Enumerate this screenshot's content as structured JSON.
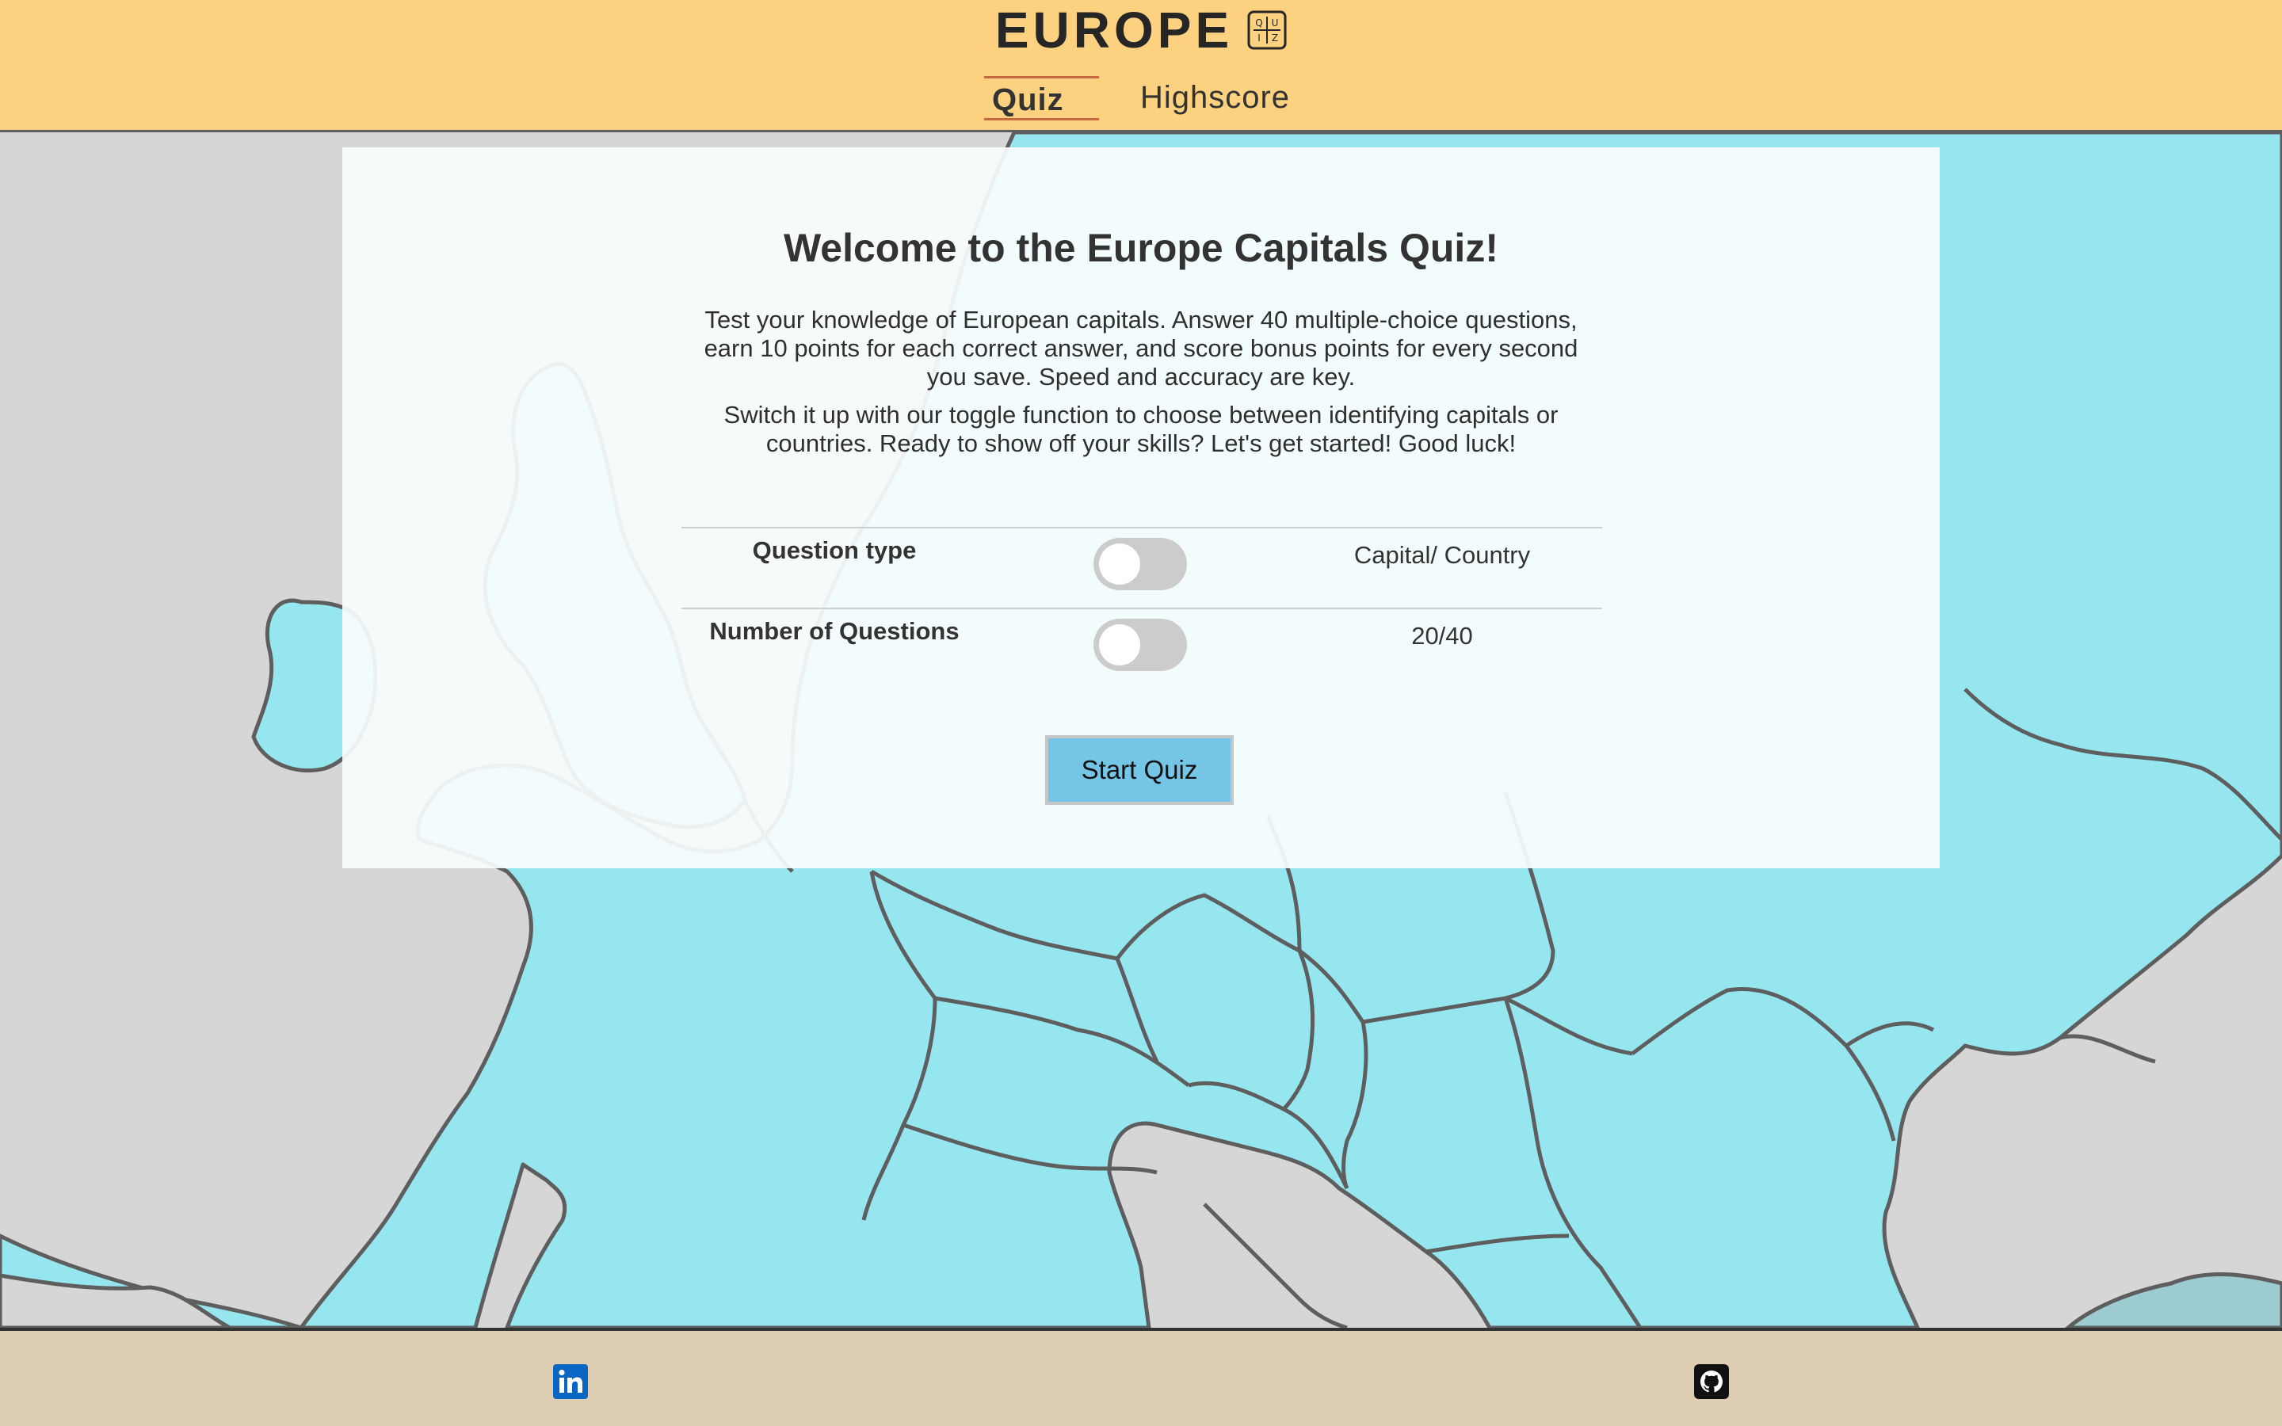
{
  "header": {
    "title": "EUROPE",
    "logo_icon": "quiz-logo-icon",
    "logo_letters": [
      "Q",
      "U",
      "I",
      "Z"
    ],
    "nav": [
      {
        "label": "Quiz",
        "active": true
      },
      {
        "label": "Highscore",
        "active": false
      }
    ]
  },
  "card": {
    "title": "Welcome to the Europe Capitals Quiz!",
    "intro_1": "Test your knowledge of European capitals. Answer 40 multiple-choice questions, earn 10 points for each correct answer, and score bonus points for every second you save. Speed and accuracy are key.",
    "intro_2": "Switch it up with our toggle function to choose between identifying capitals or countries. Ready to show off your skills? Let's get started! Good luck!",
    "settings": [
      {
        "label": "Question type",
        "value": "Capital/ Country",
        "toggle_on": false
      },
      {
        "label": "Number of Questions",
        "value": "20/40",
        "toggle_on": false
      }
    ],
    "start_label": "Start Quiz"
  },
  "footer": {
    "links": [
      {
        "icon": "linkedin-icon"
      },
      {
        "icon": "github-icon"
      }
    ]
  },
  "colors": {
    "header_bg": "#fcd17f",
    "footer_bg": "#ddceb3",
    "map_land_highlight": "#96e6f0",
    "map_land_other": "#d6d6d6",
    "map_border": "#5e5e5e",
    "accent_underline": "#c9673f",
    "start_button": "#75c6e6",
    "toggle_off": "#cccccc"
  }
}
